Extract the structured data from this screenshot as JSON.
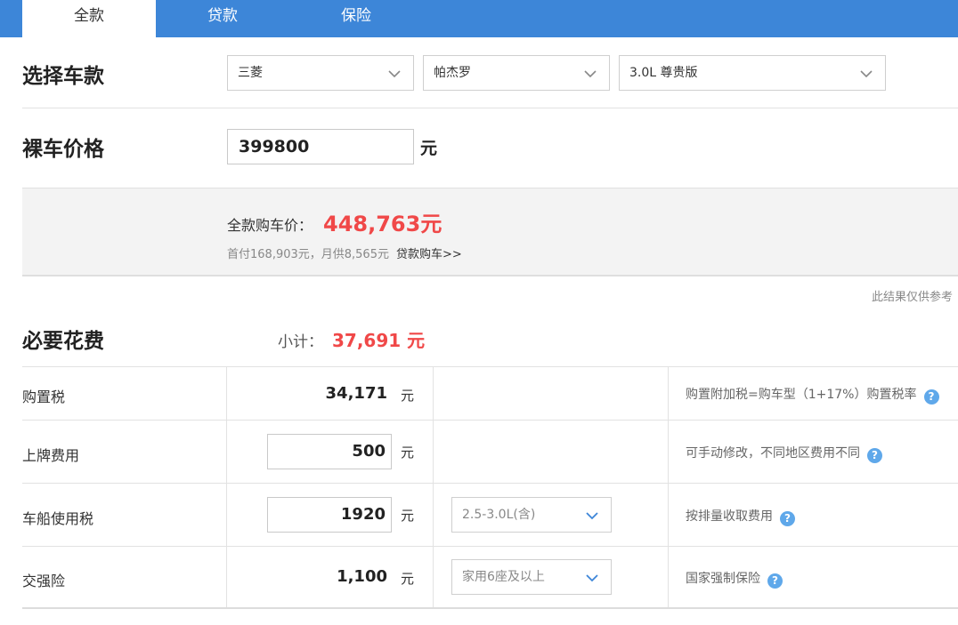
{
  "tabs": [
    {
      "label": "全款"
    },
    {
      "label": "贷款"
    },
    {
      "label": "保险"
    }
  ],
  "select_model": {
    "title": "选择车款",
    "brand": "三菱",
    "series": "帕杰罗",
    "model": "3.0L 尊贵版"
  },
  "bare_price": {
    "title": "裸车价格",
    "value": "399800",
    "unit": "元"
  },
  "summary": {
    "label": "全款购车价：",
    "value": "448,763元",
    "sub": "首付168,903元，月供8,565元",
    "loan_link": "贷款购车>>"
  },
  "note": "此结果仅供参考",
  "required": {
    "title": "必要花费",
    "subtotal_label": "小计：",
    "subtotal_value": "37,691 元"
  },
  "fees": [
    {
      "label": "购置税",
      "value": "34,171",
      "unit": "元",
      "hint": "购置附加税=购车型（1+17%）购置税率"
    },
    {
      "label": "上牌费用",
      "value": "500",
      "unit": "元",
      "hint": "可手动修改，不同地区费用不同"
    },
    {
      "label": "车船使用税",
      "value": "1920",
      "unit": "元",
      "option": "2.5-3.0L(含)",
      "hint": "按排量收取费用"
    },
    {
      "label": "交强险",
      "value": "1,100",
      "unit": "元",
      "option": "家用6座及以上",
      "hint": "国家强制保险"
    }
  ],
  "help_glyph": "?",
  "colors": {
    "tab_bar": "#3d86d8",
    "accent_red": "#f04848",
    "help_blue": "#5fa8ea"
  }
}
